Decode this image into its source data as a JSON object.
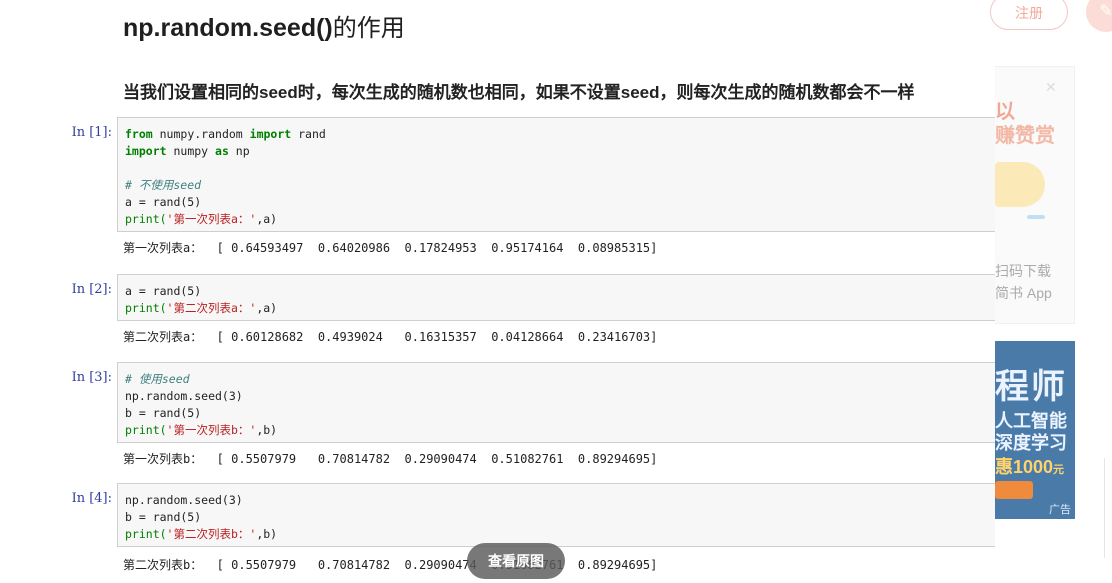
{
  "article": {
    "title_en": "np.random.seed()",
    "title_cn": "的作用",
    "subtitle": "当我们设置相同的seed时，每次生成的随机数也相同，如果不设置seed，则每次生成的随机数都会不一样"
  },
  "cells": [
    {
      "prompt": "In [1]:",
      "output": "第一次列表a：  [ 0.64593497  0.64020986  0.17824953  0.95174164  0.08985315]"
    },
    {
      "prompt": "In [2]:",
      "output": "第二次列表a：  [ 0.60128682  0.4939024   0.16315357  0.04128664  0.23416703]"
    },
    {
      "prompt": "In [3]:",
      "output": "第一次列表b：  [ 0.5507979   0.70814782  0.29090474  0.51082761  0.89294695]"
    },
    {
      "prompt": "In [4]:",
      "output": "第二次列表b：  [ 0.5507979   0.70814782  0.29090474  0.51082761  0.89294695]"
    }
  ],
  "code": {
    "c1_l1_kw1": "from",
    "c1_l1_mid": " numpy.random ",
    "c1_l1_kw2": "import",
    "c1_l1_end": " rand",
    "c1_l2_kw1": "import",
    "c1_l2_mid": " numpy ",
    "c1_l2_kw2": "as",
    "c1_l2_end": " np",
    "c1_l4": "# 不使用seed",
    "c1_l5": "a = rand(5)",
    "c1_l6_fn": "print(",
    "c1_l6_str": "'第一次列表a：'",
    "c1_l6_end": ",a)",
    "c2_l1": "a = rand(5)",
    "c2_l2_fn": "print(",
    "c2_l2_str": "'第二次列表a：'",
    "c2_l2_end": ",a)",
    "c3_l1": "# 使用seed",
    "c3_l2": "np.random.seed(3)",
    "c3_l3": "b = rand(5)",
    "c3_l4_fn": "print(",
    "c3_l4_str": "'第一次列表b：'",
    "c3_l4_end": ",b)",
    "c4_l1": "np.random.seed(3)",
    "c4_l2": "b = rand(5)",
    "c4_l3_fn": "print(",
    "c4_l3_str": "'第二次列表b：'",
    "c4_l3_end": ",b)"
  },
  "sidebar": {
    "register_label": "注册",
    "qr_text1": "以",
    "qr_text2": "赚赞赏",
    "qr_caption1": "扫码下载",
    "qr_caption2": "简书 App",
    "ad_big": "程师",
    "ad_line1": "人工智能",
    "ad_line2": "深度学习",
    "ad_price": "惠1000",
    "ad_price_unit": "元",
    "ad_label": "广告"
  },
  "overlay": {
    "view_original_label": "查看原图"
  },
  "colors": {
    "prompt": "#303f9f",
    "keyword": "#008000",
    "comment": "#408080",
    "string": "#ba2121"
  }
}
